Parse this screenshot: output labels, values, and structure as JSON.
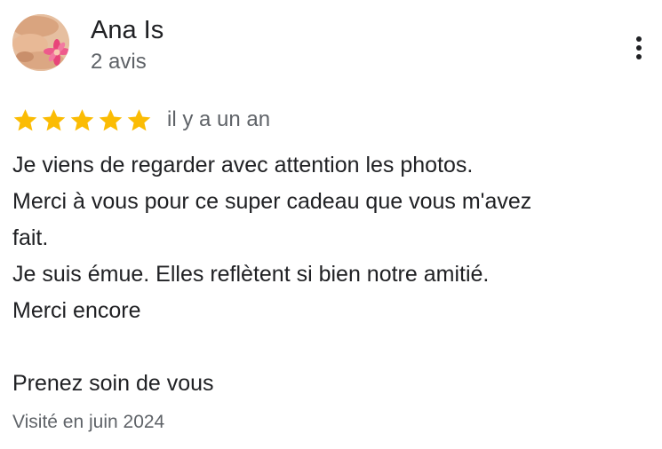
{
  "author": {
    "name": "Ana Is",
    "review_count": "2 avis"
  },
  "rating": {
    "stars": 5,
    "max_stars": 5,
    "date": "il y a un an"
  },
  "review": {
    "lines": [
      "Je viens de regarder avec attention les photos.",
      "Merci à vous pour ce super cadeau que vous m'avez",
      "fait.",
      "Je suis émue. Elles reflètent si bien notre amitié.",
      "Merci encore",
      "",
      "Prenez soin de vous"
    ]
  },
  "visited": "Visité en juin 2024",
  "icons": {
    "menu": "more-vert-icon",
    "star": "star-icon"
  },
  "colors": {
    "star": "#fbbc04",
    "text": "#202124",
    "secondary": "#5f6368"
  }
}
